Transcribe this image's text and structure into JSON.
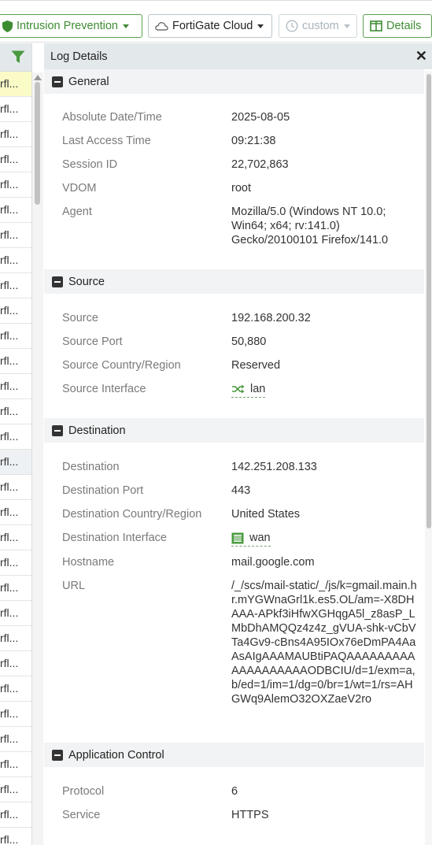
{
  "toolbar": {
    "ips_label": "Intrusion Prevention",
    "cloud_label": "FortiGate Cloud",
    "custom_label": "custom",
    "details_label": "Details"
  },
  "list": {
    "row_text": "rfl..."
  },
  "panel": {
    "title": "Log Details",
    "sections": {
      "general": {
        "title": "General",
        "rows": [
          {
            "key": "Absolute Date/Time",
            "value": "2025-08-05"
          },
          {
            "key": "Last Access Time",
            "value": "09:21:38"
          },
          {
            "key": "Session ID",
            "value": "22,702,863"
          },
          {
            "key": "VDOM",
            "value": "root"
          },
          {
            "key": "Agent",
            "value": "Mozilla/5.0 (Windows NT 10.0; Win64; x64; rv:141.0) Gecko/20100101 Firefox/141.0"
          }
        ]
      },
      "source": {
        "title": "Source",
        "rows": [
          {
            "key": "Source",
            "value": "192.168.200.32"
          },
          {
            "key": "Source Port",
            "value": "50,880"
          },
          {
            "key": "Source Country/Region",
            "value": "Reserved"
          },
          {
            "key": "Source Interface",
            "value": "lan"
          }
        ]
      },
      "destination": {
        "title": "Destination",
        "rows": [
          {
            "key": "Destination",
            "value": "142.251.208.133"
          },
          {
            "key": "Destination Port",
            "value": "443"
          },
          {
            "key": "Destination Country/Region",
            "value": "United States"
          },
          {
            "key": "Destination Interface",
            "value": "wan"
          },
          {
            "key": "Hostname",
            "value": "mail.google.com"
          },
          {
            "key": "URL",
            "value": "/_/scs/mail-static/_/js/k=gmail.main.hr.mYGWnaGrl1k.es5.OL/am=-X8DHAAA-APkf3iHfwXGHqgA5l_z8asP_LMbDhAMQQz4z4z_gVUA-shk-vCbVTa4Gv9-cBns4A95IOx76eDmPA4AaAsAIgAAAMAUBtiPAQAAAAAAAAAAAAAAAAAAAODBCIU/d=1/exm=a,b/ed=1/im=1/dg=0/br=1/wt=1/rs=AHGWq9AlemO32OXZaeV2ro"
          }
        ]
      },
      "application": {
        "title": "Application Control",
        "rows": [
          {
            "key": "Protocol",
            "value": "6"
          },
          {
            "key": "Service",
            "value": "HTTPS"
          }
        ]
      }
    }
  },
  "icons": {
    "ips": "shield-icon",
    "cloud": "cloud-icon",
    "custom": "clock-icon",
    "details": "columns-icon",
    "filter": "filter-icon",
    "close": "close-icon",
    "lan": "shuffle-icon",
    "wan": "network-port-icon"
  },
  "colors": {
    "accent_green": "#3d8c32",
    "highlight_row": "#fbfbc8",
    "header_bg": "#e3e8eb"
  }
}
